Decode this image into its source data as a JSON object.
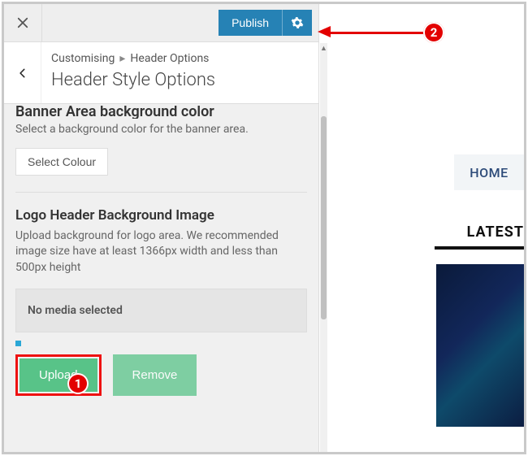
{
  "topbar": {
    "publish_label": "Publish"
  },
  "crumb": {
    "root": "Customising",
    "parent": "Header Options",
    "title": "Header Style Options"
  },
  "banner_section": {
    "heading": "Banner Area background color",
    "desc": "Select a background color for the banner area.",
    "select_colour_label": "Select Colour"
  },
  "logo_section": {
    "heading": "Logo Header Background Image",
    "desc": "Upload background for logo area. We recommended image size have at least 1366px width and less than 500px height",
    "no_media": "No media selected",
    "upload_label": "Upload",
    "remove_label": "Remove"
  },
  "preview": {
    "home": "HOME",
    "latest": "LATEST"
  },
  "annotations": {
    "one": "1",
    "two": "2"
  }
}
